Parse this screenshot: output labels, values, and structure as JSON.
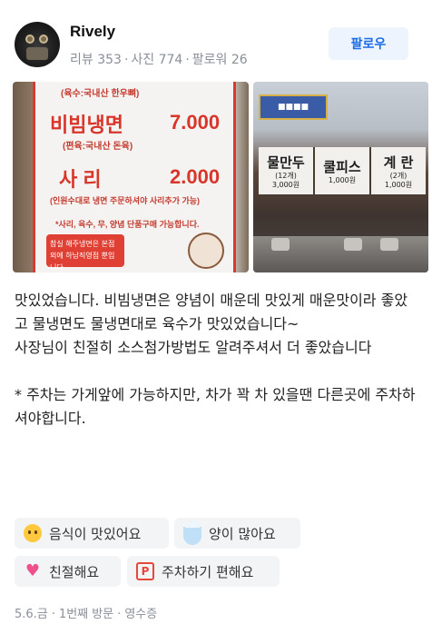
{
  "profile": {
    "username": "Rively",
    "reviews_label": "리뷰 353",
    "photos_label": "사진 774",
    "followers_label": "팔로워 26",
    "separator": "·",
    "follow_button": "팔로우"
  },
  "photos": {
    "menu_card": {
      "broth_note": "(육수:국내산 한우뼈)",
      "item1_name": "비빔냉면",
      "item1_price": "7.000",
      "item1_note": "(편육:국내산 돈육)",
      "item2_name": "사  리",
      "item2_price": "2.000",
      "item2_note": "(인원수대로 냉면 주문하셔야 사리추가 가능)",
      "extra_note": "*사리, 육수, 무, 양념 단품구매 가능합니다.",
      "red_box": "참실 해주냉면은 본점 외에 하남직영점 뿐입니다."
    },
    "signboard": {
      "items": [
        {
          "title": "물만두",
          "sub": "(12개)",
          "price": "3,000원"
        },
        {
          "title": "쿨피스",
          "sub": "",
          "price": "1,000원"
        },
        {
          "title": "계 란",
          "sub": "(2개)",
          "price": "1,000원"
        }
      ]
    }
  },
  "review": {
    "text": "맛있었습니다. 비빔냉면은 양념이 매운데 맛있게 매운맛이라 좋았고 물냉면도 물냉면대로 육수가 맛있었습니다~\n사장님이 친절히 소스첨가방법도 알려주셔서 더 좋았습니다\n\n* 주차는 가게앞에 가능하지만, 차가 꽉 차 있을땐 다른곳에 주차하셔야합니다."
  },
  "tags": [
    {
      "label": "음식이 맛있어요",
      "icon": "smile-face-icon"
    },
    {
      "label": "양이 많아요",
      "icon": "rice-bowl-icon"
    },
    {
      "label": "친절해요",
      "icon": "heart-icon"
    },
    {
      "label": "주차하기 편해요",
      "icon": "parking-icon"
    }
  ],
  "footer": {
    "date": "5.6.금",
    "visit": "1번째 방문",
    "receipt": "영수증",
    "separator": "·"
  },
  "colors": {
    "follow_text": "#1a6be6",
    "follow_bg": "#eef4fd",
    "tag_bg": "#f3f4f6",
    "muted": "#8a8f99"
  }
}
